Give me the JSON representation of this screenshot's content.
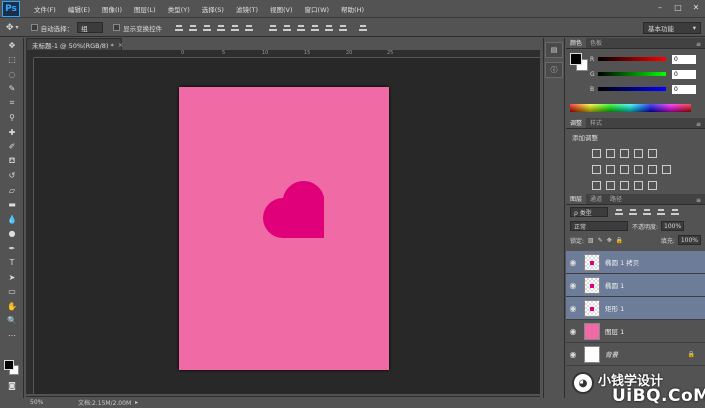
{
  "app": {
    "logo": "Ps"
  },
  "menus": [
    "文件(F)",
    "编辑(E)",
    "图像(I)",
    "图层(L)",
    "类型(Y)",
    "选择(S)",
    "滤镜(T)",
    "视图(V)",
    "窗口(W)",
    "帮助(H)"
  ],
  "window_controls": [
    "–",
    "□",
    "✕"
  ],
  "options": {
    "auto_select_label": "自动选择：",
    "auto_select_value": "组",
    "show_transform_label": "显示变换控件",
    "workspace": "基本功能"
  },
  "document": {
    "tab_title": "未标题-1 @ 50%(RGB/8) *",
    "tab_close": "×",
    "zoom": "50%",
    "doc_info": "文档:2.15M/2.00M",
    "artboard_color": "#f06ba6",
    "heart_color": "#e0007a"
  },
  "ruler_labels": [
    "0",
    "5",
    "10",
    "15",
    "20",
    "25"
  ],
  "color_panel": {
    "tabs": [
      "颜色",
      "色板"
    ],
    "channels": [
      {
        "label": "R",
        "value": "0"
      },
      {
        "label": "G",
        "value": "0"
      },
      {
        "label": "B",
        "value": "0"
      }
    ]
  },
  "adjustments_panel": {
    "tabs": [
      "调整",
      "样式"
    ],
    "title": "添加调整"
  },
  "layers_panel": {
    "tabs": [
      "图层",
      "通道",
      "路径"
    ],
    "filter_label": "ρ 类型",
    "blend_mode": "正常",
    "opacity_label": "不透明度:",
    "opacity_value": "100%",
    "lock_label": "锁定:",
    "fill_label": "填充:",
    "fill_value": "100%",
    "layers": [
      {
        "name": "椭圆 1 拷贝",
        "selected": true,
        "thumb": "check",
        "italic": false
      },
      {
        "name": "椭圆 1",
        "selected": true,
        "thumb": "check",
        "italic": false
      },
      {
        "name": "矩形 1",
        "selected": true,
        "thumb": "check",
        "italic": false
      },
      {
        "name": "图层 1",
        "selected": false,
        "thumb": "pink",
        "italic": false
      },
      {
        "name": "背景",
        "selected": false,
        "thumb": "white",
        "italic": true
      }
    ]
  },
  "watermark": {
    "text": "小钱学设计",
    "site": "UiBQ.CoM"
  }
}
